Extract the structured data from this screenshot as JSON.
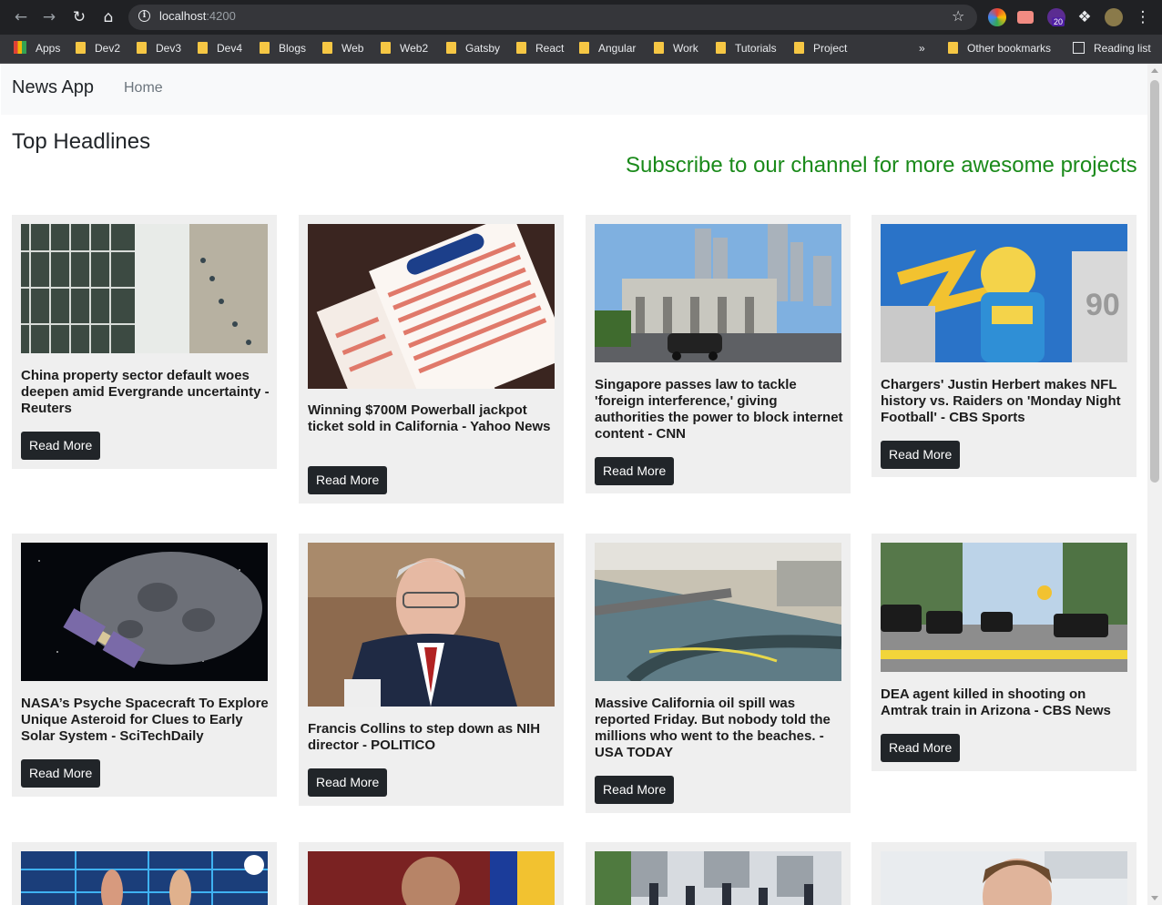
{
  "browser": {
    "url_host": "localhost",
    "url_port": ":4200",
    "extension_badge": "20",
    "bookmarks": [
      "Apps",
      "Dev2",
      "Dev3",
      "Dev4",
      "Blogs",
      "Web",
      "Web2",
      "Gatsby",
      "React",
      "Angular",
      "Work",
      "Tutorials",
      "Project"
    ],
    "overflow": "»",
    "other_bookmarks": "Other bookmarks",
    "reading_list": "Reading list"
  },
  "navbar": {
    "brand": "News App",
    "home": "Home"
  },
  "page": {
    "heading": "Top Headlines",
    "marquee": "Subscribe to our channel for more awesome projects"
  },
  "articles": [
    {
      "title": "China property sector default woes deepen amid Evergrande uncertainty - Reuters",
      "button": "Read More"
    },
    {
      "title": "Winning $700M Powerball jackpot ticket sold in California - Yahoo News",
      "button": "Read More"
    },
    {
      "title": "Singapore passes law to tackle 'foreign interference,' giving authorities the power to block internet content - CNN",
      "button": "Read More"
    },
    {
      "title": "Chargers' Justin Herbert makes NFL history vs. Raiders on 'Monday Night Football' - CBS Sports",
      "button": "Read More"
    },
    {
      "title": "NASA’s Psyche Spacecraft To Explore Unique Asteroid for Clues to Early Solar System - SciTechDaily",
      "button": "Read More"
    },
    {
      "title": "Francis Collins to step down as NIH director - POLITICO",
      "button": "Read More"
    },
    {
      "title": "Massive California oil spill was reported Friday. But nobody told the millions who went to the beaches. - USA TODAY",
      "button": "Read More"
    },
    {
      "title": "DEA agent killed in shooting on Amtrak train in Arizona - CBS News",
      "button": "Read More"
    }
  ],
  "colors": {
    "accent_green": "#1a8a1a",
    "button_dark": "#212529",
    "card_bg": "#efefef"
  }
}
